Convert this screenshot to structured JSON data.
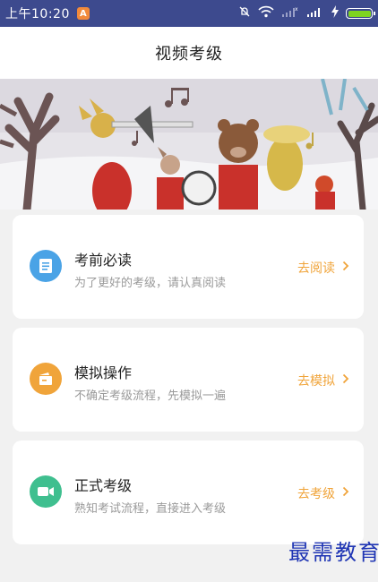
{
  "status_bar": {
    "time": "上午10:20",
    "app_badge": "A",
    "icons": [
      "mute-icon",
      "wifi-icon",
      "signal-icon",
      "signal-icon",
      "charging-icon",
      "battery-icon"
    ],
    "battery_color": "#7ed321",
    "bg_color": "#3d4a8e"
  },
  "header": {
    "title": "视频考级"
  },
  "banner": {
    "description_icon": "band-animals-illustration"
  },
  "cards": [
    {
      "title": "考前必读",
      "subtitle": "为了更好的考级，请认真阅读",
      "action": "去阅读",
      "icon": "document-icon",
      "icon_color": "#4aa3e6"
    },
    {
      "title": "模拟操作",
      "subtitle": "不确定考级流程，先模拟一遍",
      "action": "去模拟",
      "icon": "simulation-icon",
      "icon_color": "#f0a43a"
    },
    {
      "title": "正式考级",
      "subtitle": "熟知考试流程，直接进入考级",
      "action": "去考级",
      "icon": "video-camera-icon",
      "icon_color": "#3fbf8f"
    }
  ],
  "accent_color": "#f0a43a",
  "watermark": "最需教育"
}
